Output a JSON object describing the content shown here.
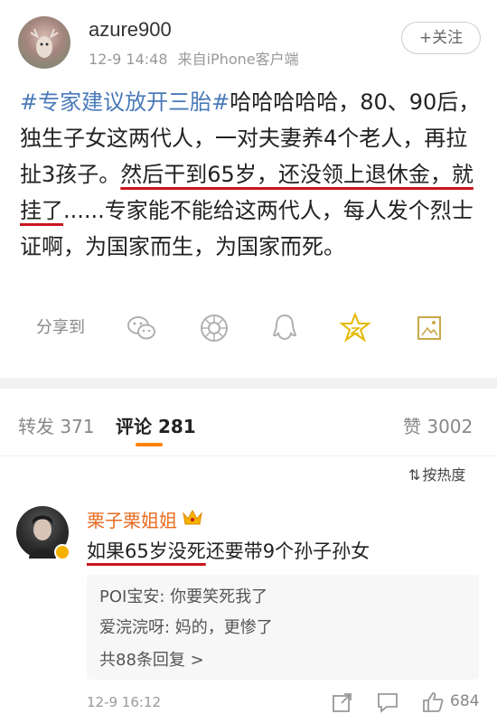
{
  "post": {
    "username": "azure900",
    "timestamp": "12-9 14:48",
    "source": "来自iPhone客户端",
    "follow_label": "+关注",
    "hashtag": "#专家建议放开三胎#",
    "text_part1": "哈哈哈哈哈，80、90后，独生子女这两代人，一对夫妻养4个老人，再拉扯3孩子。",
    "text_highlight1": "然后干到65岁，还没领上退休金，就挂了",
    "text_part2": "......专家能不能给这两代人，每人发个烈士证啊，为国家而生，为国家而死。"
  },
  "share": {
    "label": "分享到",
    "icons": [
      "wechat-icon",
      "moments-icon",
      "qq-icon",
      "qzone-icon",
      "image-save-icon"
    ]
  },
  "tabs": {
    "repost": "转发 371",
    "comment": "评论 281",
    "like": "赞 3002"
  },
  "sort": {
    "label": "按热度"
  },
  "comment": {
    "name": "栗子栗姐姐",
    "text_highlight": "如果65岁没死",
    "text_rest": "还要带9个孙子孙女",
    "replies": [
      {
        "text": "POI宝安: 你要笑死我了"
      },
      {
        "text": "爱浣浣呀: 妈的，更惨了"
      }
    ],
    "more_replies": "共88条回复 >",
    "time": "12-9 16:12",
    "like_count": "684"
  },
  "colors": {
    "accent": "#ff8200",
    "hashtag": "#4a7ab8",
    "underline": "#c8161d",
    "name": "#e86b1f"
  }
}
